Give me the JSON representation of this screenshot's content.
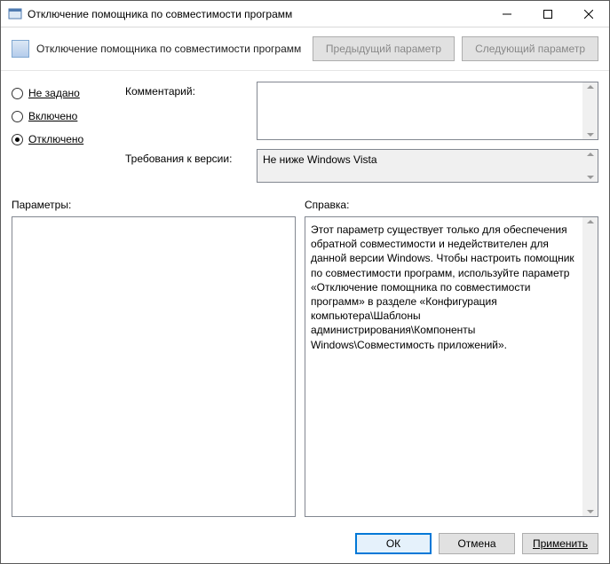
{
  "window": {
    "title": "Отключение помощника по совместимости программ"
  },
  "toolbar": {
    "app_title": "Отключение помощника по совместимости программ",
    "prev_label": "Предыдущий параметр",
    "next_label": "Следующий параметр"
  },
  "radios": {
    "not_configured": "Не задано",
    "enabled": "Включено",
    "disabled": "Отключено",
    "selected": "disabled"
  },
  "fields": {
    "comment_label": "Комментарий:",
    "comment_value": "",
    "requirements_label": "Требования к версии:",
    "requirements_value": "Не ниже Windows Vista"
  },
  "sections": {
    "parameters_label": "Параметры:",
    "help_label": "Справка:",
    "parameters_text": "",
    "help_text": "Этот параметр существует только для обеспечения обратной совместимости и недействителен для данной версии Windows. Чтобы настроить помощник по совместимости программ, используйте параметр «Отключение помощника по совместимости программ» в разделе «Конфигурация компьютера\\Шаблоны администрирования\\Компоненты Windows\\Совместимость приложений»."
  },
  "buttons": {
    "ok": "ОК",
    "cancel": "Отмена",
    "apply": "Применить"
  }
}
